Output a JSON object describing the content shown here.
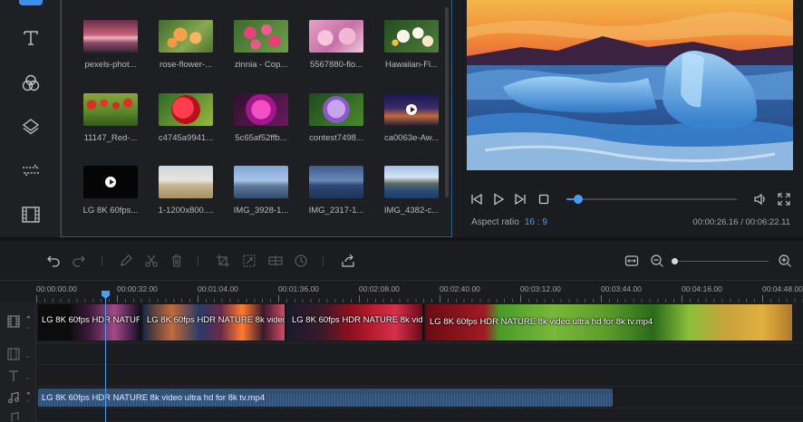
{
  "library": {
    "items": [
      {
        "label": "pexels-phot...",
        "video": false
      },
      {
        "label": "rose-flower-...",
        "video": false
      },
      {
        "label": "zinnia - Cop...",
        "video": false
      },
      {
        "label": "5567880-flo...",
        "video": false
      },
      {
        "label": "Hawaiian-Fl...",
        "video": false
      },
      {
        "label": "11147_Red-...",
        "video": false
      },
      {
        "label": "c4745a9941...",
        "video": false
      },
      {
        "label": "5c65af52ffb...",
        "video": false
      },
      {
        "label": "contest7498...",
        "video": false
      },
      {
        "label": "ca0063e-Aw...",
        "video": true
      },
      {
        "label": "LG 8K 60fps...",
        "video": true
      },
      {
        "label": "1-1200x800....",
        "video": false
      },
      {
        "label": "IMG_3928-1...",
        "video": false
      },
      {
        "label": "IMG_2317-1...",
        "video": false
      },
      {
        "label": "IMG_4382-c...",
        "video": false
      }
    ]
  },
  "preview": {
    "aspect_label": "Aspect ratio",
    "aspect_value": "16 : 9",
    "current_time": "00:00:26.16",
    "total_time": "00:06:22.11",
    "time_separator": "/",
    "progress_fraction": 0.07
  },
  "timeline": {
    "ruler": [
      "00:00:00.00",
      "00:00:32.00",
      "00:01:04.00",
      "00:01:36.00",
      "00:02:08.00",
      "00:02:40.00",
      "00:03:12.00",
      "00:03:44.00",
      "00:04:16.00",
      "00:04:48.00"
    ],
    "zoom_fraction": 0.0,
    "video_clips": [
      {
        "label": "LG 8K 60fps HDR NATURE"
      },
      {
        "label": "LG 8K 60fps HDR NATURE 8k video"
      },
      {
        "label": "LG 8K 60fps HDR NATURE 8k vide"
      },
      {
        "label": "LG 8K 60fps HDR NATURE 8k video ultra hd for 8k tv.mp4"
      }
    ],
    "audio_clip": {
      "label": "LG 8K 60fps HDR NATURE 8k video ultra hd for 8k tv.mp4"
    }
  },
  "colors": {
    "accent": "#3a8ff0",
    "panel": "#1e1f22",
    "background": "#1b1c1f"
  }
}
